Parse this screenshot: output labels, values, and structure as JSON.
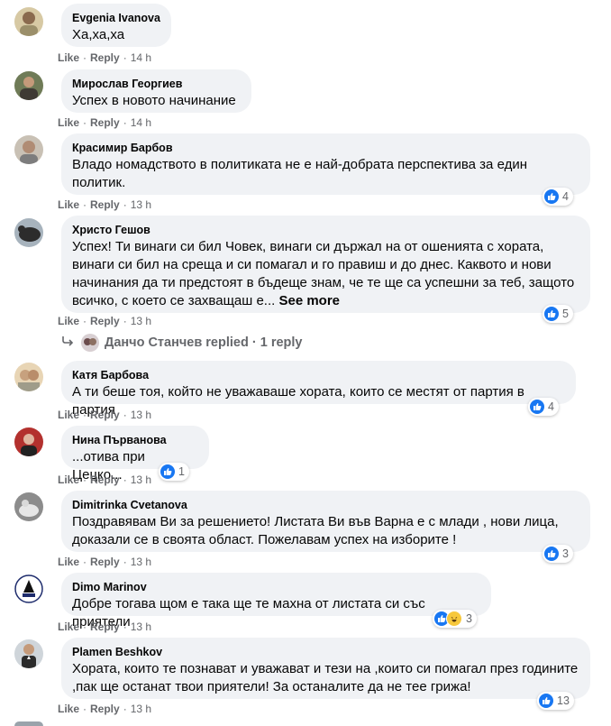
{
  "actions": {
    "like": "Like",
    "reply": "Reply",
    "dot": "·"
  },
  "comments": [
    {
      "author": "Evgenia Ivanova",
      "text": "Ха,ха,ха",
      "time": "14 h"
    },
    {
      "author": "Мирослав Георгиев",
      "text": "Успех в новото начинание",
      "time": "14 h"
    },
    {
      "author": "Красимир Барбов",
      "text": "Владо номадството в политиката не е най-добрата перспектива за един политик.",
      "time": "13 h",
      "reactions": "4"
    },
    {
      "author": "Христо Гешов",
      "text": "Успех! Ти винаги си бил Човек, винаги си държал на от ошенията с хората, винаги си бил на среща и си помагал и го правиш и до днес. Каквото и нови начинания да ти предстоят в бъдеще знам, че те ще са успешни за теб, защото всичко, с което се захващаш е...",
      "see_more": "See more",
      "time": "13 h",
      "reactions": "5"
    },
    {
      "author": "Катя Барбова",
      "text": "А ти беше тоя, който не уважаваше хората, които се местят от партия в партия",
      "time": "13 h",
      "reactions": "4"
    },
    {
      "author": "Нина Първанова",
      "text": "...отива при Цецко...",
      "time": "13 h",
      "reactions": "1"
    },
    {
      "author": "Dimitrinka Cvetanova",
      "text": "Поздравявам Ви за решението! Листата Ви във Варна е с млади , нови лица, доказали се в своята област. Пожелавам успех на изборите !",
      "time": "13 h",
      "reactions": "3"
    },
    {
      "author": "Dimo Marinov",
      "text": "Добре тогава щом е така ще те махна от листата си със приятели",
      "time": "13 h",
      "reactions": "3"
    },
    {
      "author": "Plamen Beshkov",
      "text": "Хората, които те познават и уважават и тези на ,които си помагал през годините ,пак ще останат твои приятели! За останалите да не тее грижа!",
      "time": "13 h",
      "reactions": "13"
    }
  ],
  "replies": {
    "name": "Данчо Станчев",
    "replied": "replied",
    "count": "1 reply"
  },
  "icons": {
    "like": "like-reaction-icon",
    "haha": "haha-reaction-icon",
    "reply_arrow": "reply-arrow-icon"
  },
  "colors": {
    "like_blue": "#1877f2",
    "bubble": "#f0f2f5",
    "meta": "#65676b"
  }
}
